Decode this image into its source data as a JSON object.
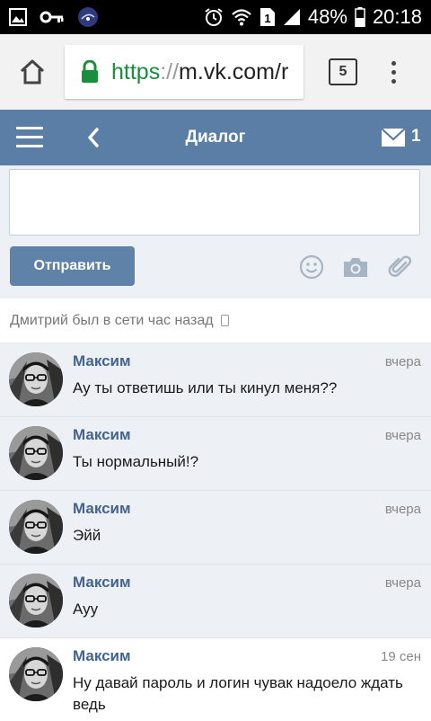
{
  "status_bar": {
    "battery": "48%",
    "time": "20:18",
    "sim_slot": "1"
  },
  "browser": {
    "url_scheme": "https",
    "url_separator": "://",
    "url_host": "m.vk.com/r",
    "tab_count": "5"
  },
  "header": {
    "title": "Диалог",
    "mail_count": "1",
    "accent_color": "#5b7ea7"
  },
  "compose": {
    "message_value": "",
    "send_label": "Отправить"
  },
  "presence": {
    "text": "Дмитрий был в сети час назад"
  },
  "messages": [
    {
      "author": "Максим",
      "time": "вчера",
      "text": "Ау ты ответишь или ты кинул меня??"
    },
    {
      "author": "Максим",
      "time": "вчера",
      "text": "Ты нормальный!?"
    },
    {
      "author": "Максим",
      "time": "вчера",
      "text": "Эйй"
    },
    {
      "author": "Максим",
      "time": "вчера",
      "text": "Ауу"
    },
    {
      "author": "Максим",
      "time": "19 сен",
      "text": "Ну давай пароль и логин чувак надоело ждать ведь"
    }
  ]
}
